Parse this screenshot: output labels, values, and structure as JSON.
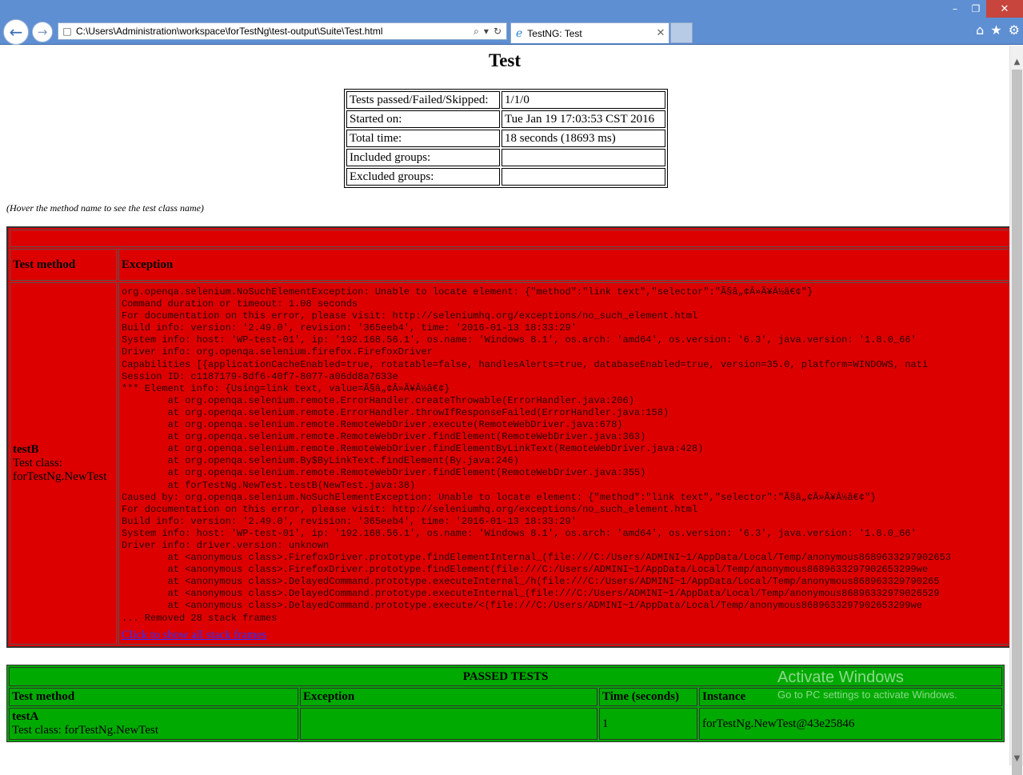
{
  "browser": {
    "address": "C:\\Users\\Administration\\workspace\\forTestNg\\test-output\\Suite\\Test.html",
    "tab_title": "TestNG: Test"
  },
  "page": {
    "title": "Test",
    "summary": [
      {
        "label": "Tests passed/Failed/Skipped:",
        "value": "1/1/0"
      },
      {
        "label": "Started on:",
        "value": "Tue Jan 19 17:03:53 CST 2016"
      },
      {
        "label": "Total time:",
        "value": "18 seconds (18693 ms)"
      },
      {
        "label": "Included groups:",
        "value": ""
      },
      {
        "label": "Excluded groups:",
        "value": ""
      }
    ],
    "hint": "(Hover the method name to see the test class name)"
  },
  "failed": {
    "header_method": "Test method",
    "header_exception": "Exception",
    "method_name": "testB",
    "class_label": "Test class:",
    "class_name": "forTestNg.NewTest",
    "stack_trace": "org.openqa.selenium.NoSuchElementException: Unable to locate element: {\"method\":\"link text\",\"selector\":\"Ã§â„¢Â»Ã¥Â½â€¢\"}\nCommand duration or timeout: 1.08 seconds\nFor documentation on this error, please visit: http://seleniumhq.org/exceptions/no_such_element.html\nBuild info: version: '2.49.0', revision: '365eeb4', time: '2016-01-13 18:33:29'\nSystem info: host: 'WP-test-01', ip: '192.168.56.1', os.name: 'Windows 8.1', os.arch: 'amd64', os.version: '6.3', java.version: '1.8.0_66'\nDriver info: org.openqa.selenium.firefox.FirefoxDriver\nCapabilities [{applicationCacheEnabled=true, rotatable=false, handlesAlerts=true, databaseEnabled=true, version=35.0, platform=WINDOWS, nati\nSession ID: c1187179-8df6-40f7-8077-a06dd8a7633e\n*** Element info: {Using=link text, value=Ã§â„¢Â»Ã¥Â½â€¢}\n        at org.openqa.selenium.remote.ErrorHandler.createThrowable(ErrorHandler.java:206)\n        at org.openqa.selenium.remote.ErrorHandler.throwIfResponseFailed(ErrorHandler.java:158)\n        at org.openqa.selenium.remote.RemoteWebDriver.execute(RemoteWebDriver.java:678)\n        at org.openqa.selenium.remote.RemoteWebDriver.findElement(RemoteWebDriver.java:363)\n        at org.openqa.selenium.remote.RemoteWebDriver.findElementByLinkText(RemoteWebDriver.java:428)\n        at org.openqa.selenium.By$ByLinkText.findElement(By.java:246)\n        at org.openqa.selenium.remote.RemoteWebDriver.findElement(RemoteWebDriver.java:355)\n        at forTestNg.NewTest.testB(NewTest.java:38)\nCaused by: org.openqa.selenium.NoSuchElementException: Unable to locate element: {\"method\":\"link text\",\"selector\":\"Ã§â„¢Â»Ã¥Â½â€¢\"}\nFor documentation on this error, please visit: http://seleniumhq.org/exceptions/no_such_element.html\nBuild info: version: '2.49.0', revision: '365eeb4', time: '2016-01-13 18:33:29'\nSystem info: host: 'WP-test-01', ip: '192.168.56.1', os.name: 'Windows 8.1', os.arch: 'amd64', os.version: '6.3', java.version: '1.8.0_66'\nDriver info: driver.version: unknown\n        at <anonymous class>.FirefoxDriver.prototype.findElementInternal_(file:///C:/Users/ADMINI~1/AppData/Local/Temp/anonymous8689633297902653\n        at <anonymous class>.FirefoxDriver.prototype.findElement(file:///C:/Users/ADMINI~1/AppData/Local/Temp/anonymous8689633297902653299we\n        at <anonymous class>.DelayedCommand.prototype.executeInternal_/h(file:///C:/Users/ADMINI~1/AppData/Local/Temp/anonymous868963329790265\n        at <anonymous class>.DelayedCommand.prototype.executeInternal_(file:///C:/Users/ADMINI~1/AppData/Local/Temp/anonymous86896332979026529\n        at <anonymous class>.DelayedCommand.prototype.execute/<(file:///C:/Users/ADMINI~1/AppData/Local/Temp/anonymous8689633297902653299we\n... Removed 28 stack frames",
    "show_frames_link": "Click to show all stack frames"
  },
  "passed": {
    "caption": "PASSED TESTS",
    "headers": [
      "Test method",
      "Exception",
      "Time (seconds)",
      "Instance"
    ],
    "row": {
      "method_name": "testA",
      "class_label": "Test class: forTestNg.NewTest",
      "exception": "",
      "time": "1",
      "instance": "forTestNg.NewTest@43e25846"
    }
  },
  "watermark": {
    "line1": "Activate Windows",
    "line2": "Go to PC settings to activate Windows."
  }
}
